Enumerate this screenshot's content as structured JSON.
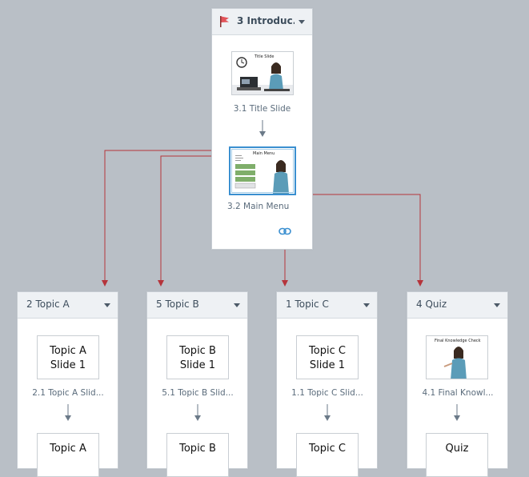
{
  "scenes": {
    "intro": {
      "title": "3  Introduc...",
      "slides": [
        {
          "label": "3.1 Title Slide",
          "thumb_title": "Title Slide"
        },
        {
          "label": "3.2 Main Menu",
          "thumb_title": "Main Menu"
        }
      ]
    },
    "topic_a": {
      "title": "2 Topic A",
      "slides": [
        {
          "label": "2.1 Topic A Slid...",
          "thumb_line1": "Topic A",
          "thumb_line2": "Slide 1"
        },
        {
          "thumb_line1": "Topic A"
        }
      ]
    },
    "topic_b": {
      "title": "5 Topic B",
      "slides": [
        {
          "label": "5.1 Topic B Slid...",
          "thumb_line1": "Topic B",
          "thumb_line2": "Slide 1"
        },
        {
          "thumb_line1": "Topic B"
        }
      ]
    },
    "topic_c": {
      "title": "1 Topic C",
      "slides": [
        {
          "label": "1.1 Topic C Slid...",
          "thumb_line1": "Topic C",
          "thumb_line2": "Slide 1"
        },
        {
          "thumb_line1": "Topic C"
        }
      ]
    },
    "quiz": {
      "title": "4 Quiz",
      "slides": [
        {
          "label": "4.1 Final Knowl...",
          "thumb_title": "Final Knowledge Check"
        },
        {
          "thumb_line1": "Quiz"
        }
      ]
    }
  },
  "colors": {
    "canvas": "#b9bfc6",
    "connector": "#b5343b",
    "selected_border": "#3a8fd0",
    "flag": "#e2545a"
  },
  "icons": {
    "scene_flag": "flag-icon",
    "dropdown": "chevron-down-icon",
    "link": "chain-link-icon",
    "flow": "down-arrow-icon"
  }
}
